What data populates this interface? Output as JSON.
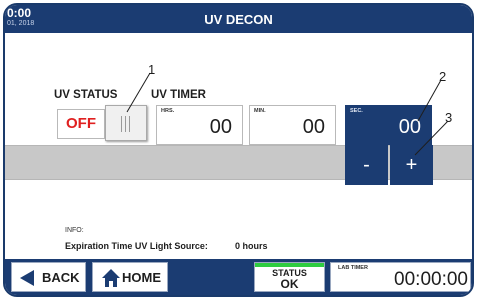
{
  "header": {
    "time": "0:00",
    "date": "01, 2018",
    "title": "UV DECON"
  },
  "uv_status": {
    "label": "UV STATUS",
    "toggle_value": "OFF"
  },
  "uv_timer": {
    "label": "UV TIMER",
    "hours": {
      "caption": "HRS.",
      "value": "00"
    },
    "minutes": {
      "caption": "MIN.",
      "value": "00"
    },
    "seconds": {
      "caption": "SEC.",
      "value": "00"
    }
  },
  "stepper": {
    "minus_label": "-",
    "plus_label": "+"
  },
  "callouts": [
    "1",
    "2",
    "3"
  ],
  "info": {
    "label": "INFO:",
    "expiration_label": "Expiration Time UV Light Source:",
    "expiration_value": "0 hours"
  },
  "footer": {
    "back_label": "BACK",
    "home_label": "HOME",
    "status_label": "STATUS",
    "status_value": "OK",
    "lab_timer_label": "LAB TIMER",
    "lab_timer_value": "00:00:00"
  },
  "colors": {
    "brand_navy": "#1b3c72",
    "status_ok": "#2ecc40",
    "off_red": "#e02020"
  },
  "icons": [
    "back-arrow-icon",
    "home-icon",
    "toggle-grip-icon"
  ]
}
